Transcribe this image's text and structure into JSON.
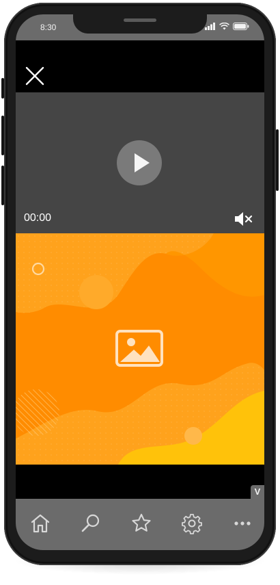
{
  "status_bar": {
    "time": "8:30",
    "icons": [
      "signal-icon",
      "wifi-icon",
      "battery-icon"
    ]
  },
  "top_bar": {
    "close_icon": "close-icon"
  },
  "video": {
    "current_time": "00:00",
    "play_icon": "play-icon",
    "mute_icon": "speaker-muted-icon"
  },
  "image_area": {
    "placeholder_icon": "image-icon",
    "colors": {
      "background": "#ff8c00",
      "accent_light": "#ffa620",
      "accent_yellow": "#ffc20a"
    }
  },
  "bottom_bar": {
    "badge_label": "V"
  },
  "tab_bar": {
    "tabs": [
      {
        "icon": "home-icon"
      },
      {
        "icon": "search-icon"
      },
      {
        "icon": "star-icon"
      },
      {
        "icon": "gear-icon"
      },
      {
        "icon": "more-icon"
      }
    ]
  }
}
